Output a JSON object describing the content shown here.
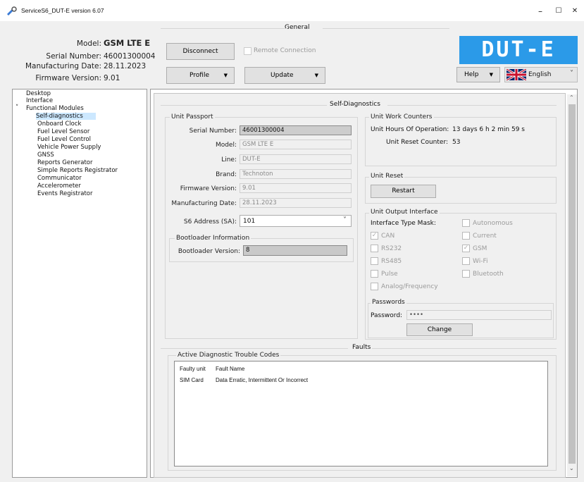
{
  "window": {
    "title": "ServiceS6_DUT-E version 6.07",
    "minimize": "–",
    "maximize": "☐",
    "close": "✕"
  },
  "header": {
    "general_title": "General",
    "model_label": "Model:",
    "model_value": "GSM LTE E",
    "serial_label": "Serial Number:",
    "serial_value": "46001300004",
    "mfg_label": "Manufacturing Date:",
    "mfg_value": "28.11.2023",
    "fw_label": "Firmware Version:",
    "fw_value": "9.01",
    "disconnect": "Disconnect",
    "remote": "Remote Connection",
    "profile": "Profile",
    "update": "Update",
    "help": "Help",
    "language": "English",
    "logo": "DUT-E"
  },
  "tree": {
    "items": [
      "Desktop",
      "Interface",
      "Functional Modules",
      "Self-diagnostics",
      "Onboard Clock",
      "Fuel Level Sensor",
      "Fuel Level Control",
      "Vehicle Power Supply",
      "GNSS",
      "Reports Generator",
      "Simple Reports Registrator",
      "Communicator",
      "Accelerometer",
      "Events Registrator"
    ],
    "expander": "˅"
  },
  "self_diag": {
    "title": "Self-Diagnostics",
    "passport": {
      "title": "Unit Passport",
      "serial_label": "Serial Number:",
      "serial_value": "46001300004",
      "model_label": "Model:",
      "model_value": "GSM LTE E",
      "line_label": "Line:",
      "line_value": "DUT-E",
      "brand_label": "Brand:",
      "brand_value": "Technoton",
      "fw_label": "Firmware Version:",
      "fw_value": "9.01",
      "mfg_label": "Manufacturing Date:",
      "mfg_value": "28.11.2023",
      "sa_label": "S6 Address (SA):",
      "sa_value": "101"
    },
    "bootloader": {
      "title": "Bootloader Information",
      "label": "Bootloader Version:",
      "value": "8"
    },
    "counters": {
      "title": "Unit Work Counters",
      "hours_label": "Unit Hours Of Operation:",
      "hours_value": "13 days 6 h 2 min 59 s",
      "reset_label": "Unit Reset Counter:",
      "reset_value": "53"
    },
    "reset": {
      "title": "Unit Reset",
      "restart": "Restart"
    },
    "output": {
      "title": "Unit Output Interface",
      "mask_label": "Interface Type Mask:",
      "left": [
        {
          "label": "CAN",
          "checked": true
        },
        {
          "label": "RS232",
          "checked": false
        },
        {
          "label": "RS485",
          "checked": false
        },
        {
          "label": "Pulse",
          "checked": false
        },
        {
          "label": "Analog/Frequency",
          "checked": false
        }
      ],
      "right": [
        {
          "label": "Autonomous",
          "checked": false
        },
        {
          "label": "Current",
          "checked": false
        },
        {
          "label": "GSM",
          "checked": true
        },
        {
          "label": "Wi-Fi",
          "checked": false
        },
        {
          "label": "Bluetooth",
          "checked": false
        }
      ]
    },
    "passwords": {
      "title": "Passwords",
      "label": "Password:",
      "value": "••••",
      "change": "Change"
    }
  },
  "faults": {
    "title": "Faults",
    "dtc_title": "Active Diagnostic Trouble Codes",
    "col_unit": "Faulty unit",
    "col_name": "Fault Name",
    "rows": [
      {
        "unit": "SIM Card",
        "name": "Data Erratic, Intermittent Or Incorrect"
      }
    ]
  },
  "icons": {
    "check": "✓",
    "dropdown": "▼",
    "chevron": "˅"
  }
}
